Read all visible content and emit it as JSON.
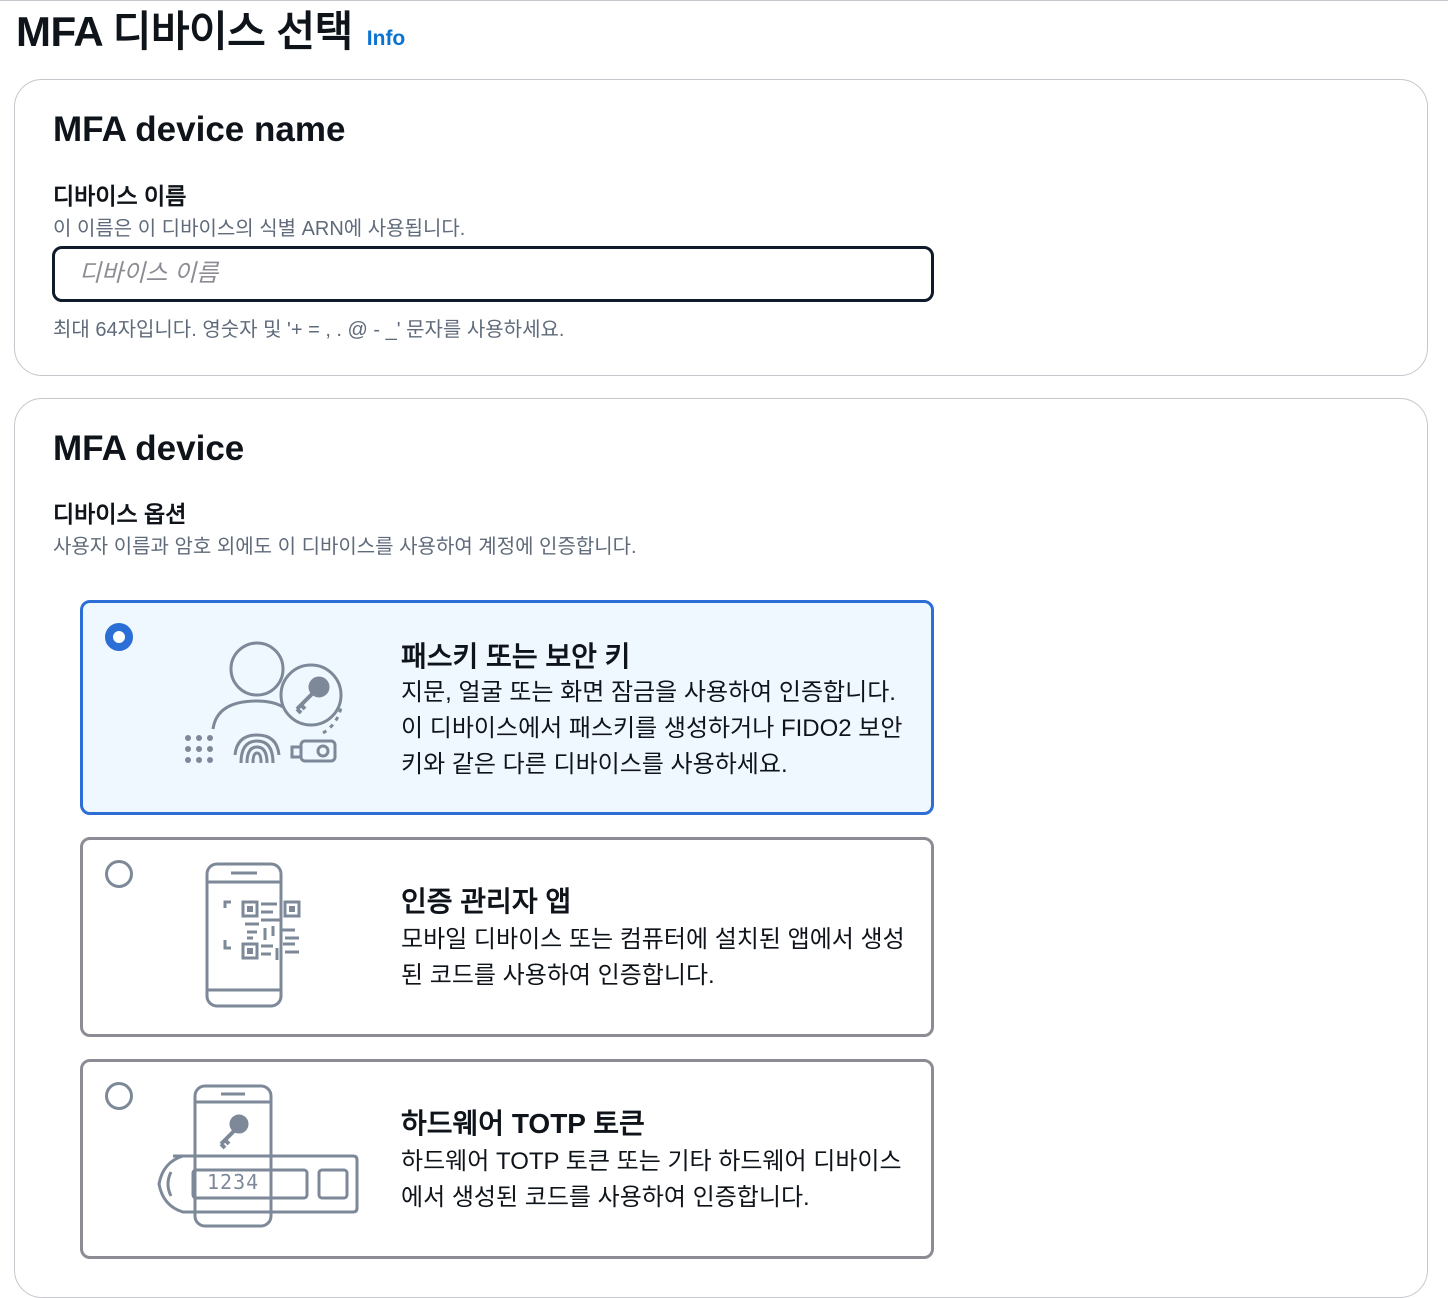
{
  "page": {
    "title": "MFA 디바이스 선택",
    "info_link": "Info"
  },
  "device_name_section": {
    "title": "MFA device name",
    "field_label": "디바이스 이름",
    "field_description": "이 이름은 이 디바이스의 식별 ARN에 사용됩니다.",
    "input_value": "",
    "input_placeholder": "디바이스 이름",
    "constraint_text": "최대 64자입니다. 영숫자 및 '+ = , . @ - _' 문자를 사용하세요."
  },
  "device_section": {
    "title": "MFA device",
    "field_label": "디바이스 옵션",
    "field_description": "사용자 이름과 암호 외에도 이 디바이스를 사용하여 계정에 인증합니다.",
    "options": [
      {
        "title": "패스키 또는 보안 키",
        "description": "지문, 얼굴 또는 화면 잠금을 사용하여 인증합니다. 이 디바이스에서 패스키를 생성하거나 FIDO2 보안 키와 같은 다른 디바이스를 사용하세요.",
        "selected": true,
        "icon": "passkey-icon"
      },
      {
        "title": "인증 관리자 앱",
        "description": "모바일 디바이스 또는 컴퓨터에 설치된 앱에서 생성된 코드를 사용하여 인증합니다.",
        "selected": false,
        "icon": "authenticator-app-icon"
      },
      {
        "title": "하드웨어 TOTP 토큰",
        "description": "하드웨어 TOTP 토큰 또는 기타 하드웨어 디바이스에서 생성된 코드를 사용하여 인증합니다.",
        "selected": false,
        "icon": "hardware-token-icon",
        "token_display": "1234"
      }
    ]
  },
  "colors": {
    "accent": "#2b6fd6",
    "link": "#0972d3",
    "selected_bg": "#f0f8ff",
    "border": "#c6c6cd"
  }
}
